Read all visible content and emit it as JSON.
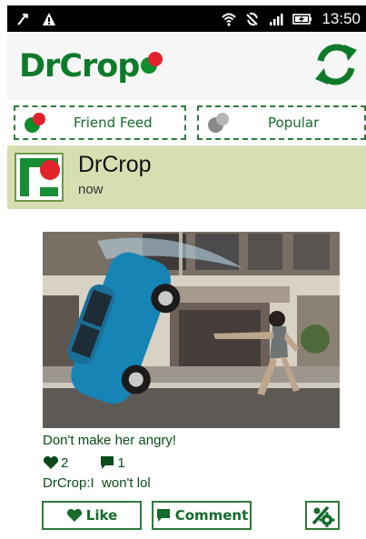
{
  "status_bar": {
    "time": "13:50",
    "left_icons": [
      "usb-debug-icon",
      "warning-icon"
    ],
    "right_icons": [
      "wifi-icon",
      "sync-icon",
      "signal-icon",
      "battery-charging-icon"
    ]
  },
  "header": {
    "logo_text": "DrCrop",
    "refresh_icon": "refresh-icon"
  },
  "tabs": [
    {
      "label": "Friend Feed",
      "icon": "friend-feed-icon"
    },
    {
      "label": "Popular",
      "icon": "popular-icon"
    }
  ],
  "post": {
    "author": "DrCrop",
    "time": "now",
    "caption": "Don't make her angry!",
    "likes": "2",
    "comments": "1",
    "comment_author": "DrCrop:",
    "comment_text": "I  won't lol"
  },
  "actions": {
    "like_label": "Like",
    "comment_label": "Comment",
    "settings_icon": "settings-icon"
  },
  "colors": {
    "brand_green": "#0f7b2a",
    "brand_red": "#e2232b",
    "profile_bg": "#d7dfb2",
    "text_green": "#0b4a1a"
  }
}
